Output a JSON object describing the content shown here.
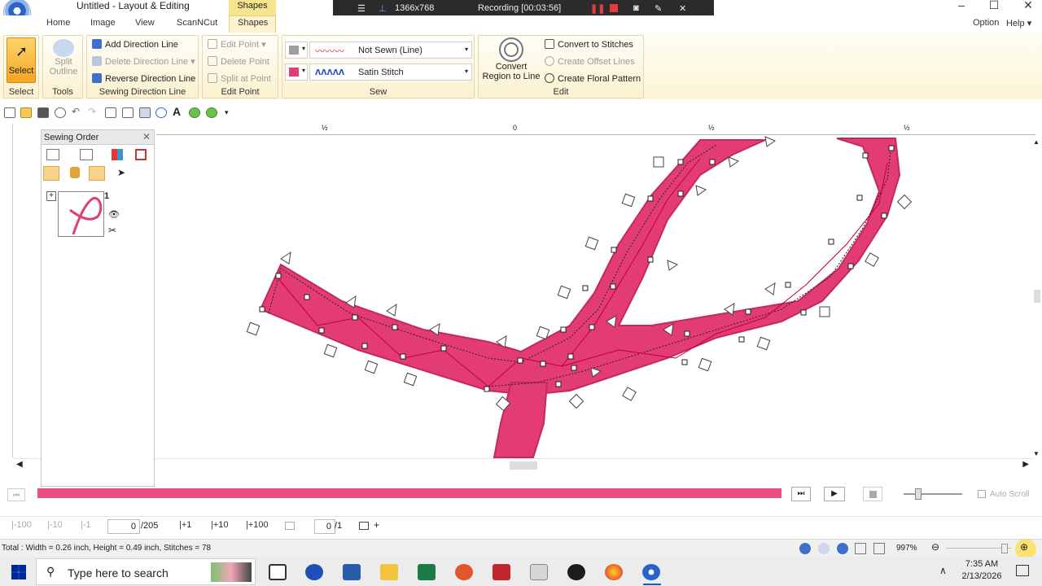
{
  "window": {
    "title": "Untitled - Layout & Editing",
    "contextual_tab": "Shapes"
  },
  "recording": {
    "resolution": "1366x768",
    "status": "Recording [00:03:56]"
  },
  "tabs": [
    {
      "label": "Home"
    },
    {
      "label": "Image"
    },
    {
      "label": "View"
    },
    {
      "label": "ScanNCut"
    },
    {
      "label": "Shapes"
    }
  ],
  "right_menu": {
    "option": "Option",
    "help": "Help"
  },
  "ribbon": {
    "select": {
      "label": "Select",
      "group": "Select"
    },
    "split_outline": {
      "label1": "Split",
      "label2": "Outline",
      "group": "Tools"
    },
    "direction": {
      "add": "Add Direction Line",
      "delete": "Delete Direction Line",
      "reverse": "Reverse Direction Line",
      "group": "Sewing Direction Line"
    },
    "edit_point": {
      "edit": "Edit Point",
      "delete": "Delete Point",
      "split": "Split at Point",
      "group": "Edit Point"
    },
    "sew": {
      "line_type": "Not Sewn (Line)",
      "region_type": "Satin Stitch",
      "group": "Sew",
      "line_color": "#9e9e9e",
      "region_color": "#e33b73"
    },
    "edit": {
      "convert_region1": "Convert",
      "convert_region2": "Region to Line",
      "to_stitches": "Convert to Stitches",
      "offset": "Create Offset Lines",
      "floral": "Create Floral Pattern",
      "group": "Edit"
    }
  },
  "rulers": {
    "top_ticks": [
      "½",
      "0",
      "½",
      "½"
    ]
  },
  "panel": {
    "title": "Sewing Order",
    "item_number": "1"
  },
  "playback": {
    "auto_scroll": "Auto Scroll",
    "progress_color": "#e94f86"
  },
  "stepper": {
    "m100": "-100",
    "m10": "-10",
    "m1": "-1",
    "position": "0",
    "total": "/205",
    "p1": "+1",
    "p10": "+10",
    "p100": "+100",
    "color_pos": "0",
    "color_total": "/1"
  },
  "status": {
    "text": "Total : Width = 0.26 inch, Height = 0.49 inch, Stitches = 78",
    "zoom": "997%"
  },
  "taskbar": {
    "search_placeholder": "Type here to search",
    "time": "7:35 AM",
    "date": "2/13/2026"
  },
  "colors": {
    "stitch": "#e33b73",
    "ribbon_accent": "#f6e58c"
  }
}
